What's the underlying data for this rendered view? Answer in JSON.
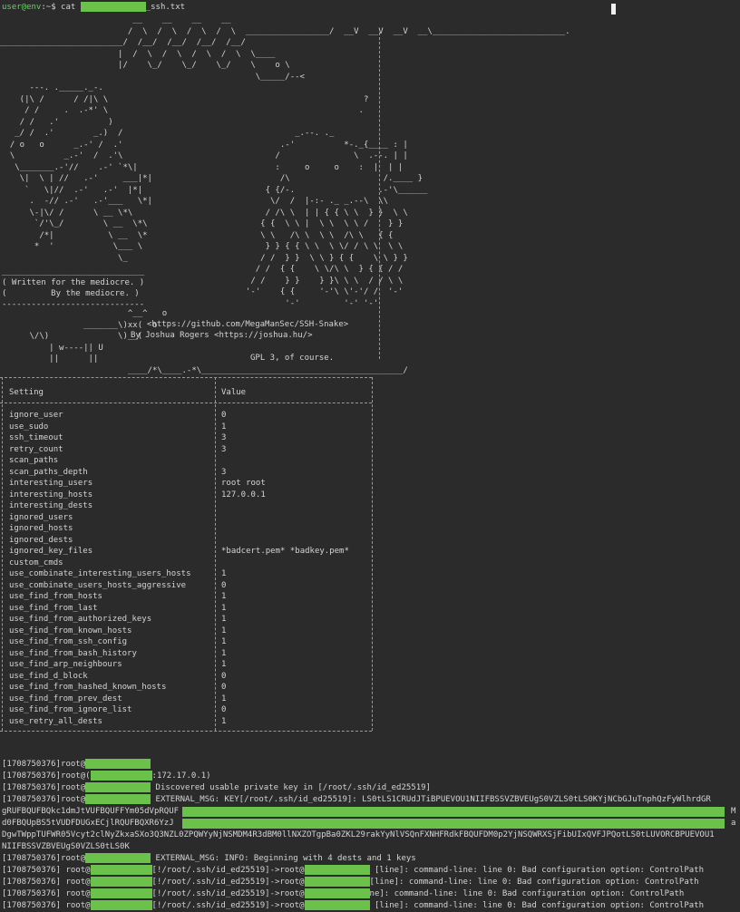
{
  "prompt": {
    "user": "user@env",
    "suffix": ":~$ cat ",
    "filename_suffix": "_ssh.txt"
  },
  "banner": {
    "art_top": "                           __    __    __    __\n                          /  \\  /  \\  /  \\  /  \\  _________________/  __V  __V  __V  __\\___________________________.\n_________________________/  /__/  /__/  /__/  /__/                                                                    \n                        |  /  \\  /  \\  /  \\  /  \\  \\____\n                        |/    \\_/    \\_/    \\_/    \\    o \\\n                                                    \\_____/--<",
    "written_1": "( Written for the mediocre. )",
    "written_2": "(         By the mediocre. )",
    "url": "<https://github.com/MegaManSec/SSH-Snake>",
    "author": "By Joshua Rogers <https://joshua.hu/>",
    "license": "GPL 3, of course."
  },
  "table": {
    "header": [
      "Setting",
      "Value"
    ],
    "rows": [
      [
        "ignore_user",
        "0"
      ],
      [
        "use_sudo",
        "1"
      ],
      [
        "ssh_timeout",
        "3"
      ],
      [
        "retry_count",
        "3"
      ],
      [
        "scan_paths",
        ""
      ],
      [
        "scan_paths_depth",
        "3"
      ],
      [
        "interesting_users",
        "root root"
      ],
      [
        "interesting_hosts",
        "127.0.0.1"
      ],
      [
        "interesting_dests",
        ""
      ],
      [
        "ignored_users",
        ""
      ],
      [
        "ignored_hosts",
        ""
      ],
      [
        "ignored_dests",
        ""
      ],
      [
        "ignored_key_files",
        "*badcert.pem* *badkey.pem*"
      ],
      [
        "custom_cmds",
        ""
      ],
      [
        "use_combinate_interesting_users_hosts",
        "1"
      ],
      [
        "use_combinate_users_hosts_aggressive",
        "0"
      ],
      [
        "use_find_from_hosts",
        "1"
      ],
      [
        "use_find_from_last",
        "1"
      ],
      [
        "use_find_from_authorized_keys",
        "1"
      ],
      [
        "use_find_from_known_hosts",
        "1"
      ],
      [
        "use_find_from_ssh_config",
        "1"
      ],
      [
        "use_find_from_bash_history",
        "1"
      ],
      [
        "use_find_arp_neighbours",
        "1"
      ],
      [
        "use_find_d_block",
        "0"
      ],
      [
        "use_find_from_hashed_known_hosts",
        "0"
      ],
      [
        "use_find_from_prev_dest",
        "1"
      ],
      [
        "use_find_from_ignore_list",
        "0"
      ],
      [
        "use_retry_all_dests",
        "1"
      ]
    ]
  },
  "log": {
    "ts": "[1708750376]",
    "line1": "root@",
    "line2a": "root@(",
    "line2b": ":172.17.0.1)",
    "line3a": "root@",
    "line3b": " Discovered usable private key in [/root/.ssh/id_ed25519]",
    "line4a": "root@",
    "line4b": " EXTERNAL_MSG: KEY[/root/.ssh/id_ed25519]: LS0tLS1CRUdJTiBPUEVOU1NIIFBSSVZBVEUgS0VZLS0tLS0KYjNCbGJuTnphQzFyWlhrdGR",
    "line5": "gRUFBQUFBQkc1dmJtVUFBQUFFYm05dVpRQUF",
    "line5end": "M",
    "line6": "d0FBQUpBS5tVUDFDUGxECjlRQUFBQXR6YzJ",
    "line6end": "a",
    "line7": "DgwTWppTUFWR05Vcyt2clNyZkxaSXo3Q3NZL0ZPQWYyNjNSMDM4R3dBM0llNXZOTgpBa0ZKL29rakYyNlVSQnFXNHFRdkFBQUFDM0p2YjNSQWRXSjFibUIxQVFJPQotLS0tLUVORCBPUEVOU1",
    "line8": "NIIFBSSVZBVEUgS0VZLS0tLS0K",
    "line9a": "root@",
    "line9b": " EXTERNAL_MSG: INFO: Beginning with 4 dests and 1 keys",
    "chain_a": "root@",
    "chain_b": "[!/root/.ssh/id_ed25519]->root@",
    "chain_msg1": " [line]: command-line: line 0: Bad configuration option: ControlPath",
    "chain_msg2": "[line]: command-line: line 0: Bad configuration option: ControlPath",
    "chain_msg3": "ne]: command-line: line 0: Bad configuration option: ControlPath",
    "chain_msg4": " [line]: command-line: line 0: Bad configuration option: ControlPath"
  },
  "colors": {
    "background": "#2b2b2b",
    "text": "#d4d4d4",
    "prompt": "#5fd75f",
    "redaction": "#6bc24a"
  }
}
